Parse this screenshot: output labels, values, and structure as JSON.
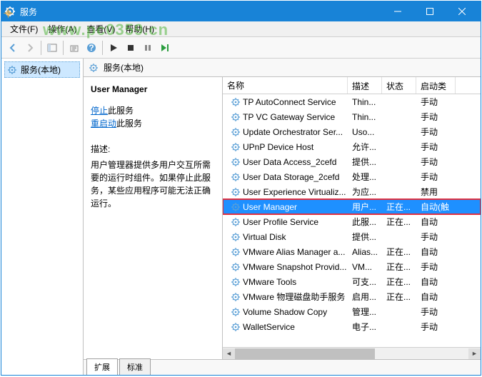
{
  "window": {
    "title": "服务"
  },
  "menu": {
    "file": "文件(F)",
    "action": "操作(A)",
    "view": "查看(V)",
    "help": "帮助(H)"
  },
  "tree": {
    "root": "服务(本地)"
  },
  "contentHeader": "服务(本地)",
  "detail": {
    "name": "User Manager",
    "stopPrefix": "停止",
    "stopSuffix": "此服务",
    "restartPrefix": "重启动",
    "restartSuffix": "此服务",
    "descLabel": "描述:",
    "desc": "用户管理器提供多用户交互所需要的运行时组件。如果停止此服务，某些应用程序可能无法正确运行。"
  },
  "columns": {
    "name": "名称",
    "desc": "描述",
    "status": "状态",
    "startup": "启动类"
  },
  "services": [
    {
      "n": "TP AutoConnect Service",
      "d": "Thin...",
      "s": "",
      "t": "手动"
    },
    {
      "n": "TP VC Gateway Service",
      "d": "Thin...",
      "s": "",
      "t": "手动"
    },
    {
      "n": "Update Orchestrator Ser...",
      "d": "Uso...",
      "s": "",
      "t": "手动"
    },
    {
      "n": "UPnP Device Host",
      "d": "允许...",
      "s": "",
      "t": "手动"
    },
    {
      "n": "User Data Access_2cefd",
      "d": "提供...",
      "s": "",
      "t": "手动"
    },
    {
      "n": "User Data Storage_2cefd",
      "d": "处理...",
      "s": "",
      "t": "手动"
    },
    {
      "n": "User Experience Virtualiz...",
      "d": "为应...",
      "s": "",
      "t": "禁用"
    },
    {
      "n": "User Manager",
      "d": "用户...",
      "s": "正在...",
      "t": "自动(触"
    },
    {
      "n": "User Profile Service",
      "d": "此服...",
      "s": "正在...",
      "t": "自动"
    },
    {
      "n": "Virtual Disk",
      "d": "提供...",
      "s": "",
      "t": "手动"
    },
    {
      "n": "VMware Alias Manager a...",
      "d": "Alias...",
      "s": "正在...",
      "t": "自动"
    },
    {
      "n": "VMware Snapshot Provid...",
      "d": "VM...",
      "s": "正在...",
      "t": "手动"
    },
    {
      "n": "VMware Tools",
      "d": "可支...",
      "s": "正在...",
      "t": "自动"
    },
    {
      "n": "VMware 物理磁盘助手服务",
      "d": "启用...",
      "s": "正在...",
      "t": "自动"
    },
    {
      "n": "Volume Shadow Copy",
      "d": "管理...",
      "s": "",
      "t": "手动"
    },
    {
      "n": "WalletService",
      "d": "电子...",
      "s": "",
      "t": "手动"
    }
  ],
  "selectedIndex": 7,
  "tabs": {
    "extended": "扩展",
    "standard": "标准"
  },
  "watermark": "www.pc0359.cn"
}
